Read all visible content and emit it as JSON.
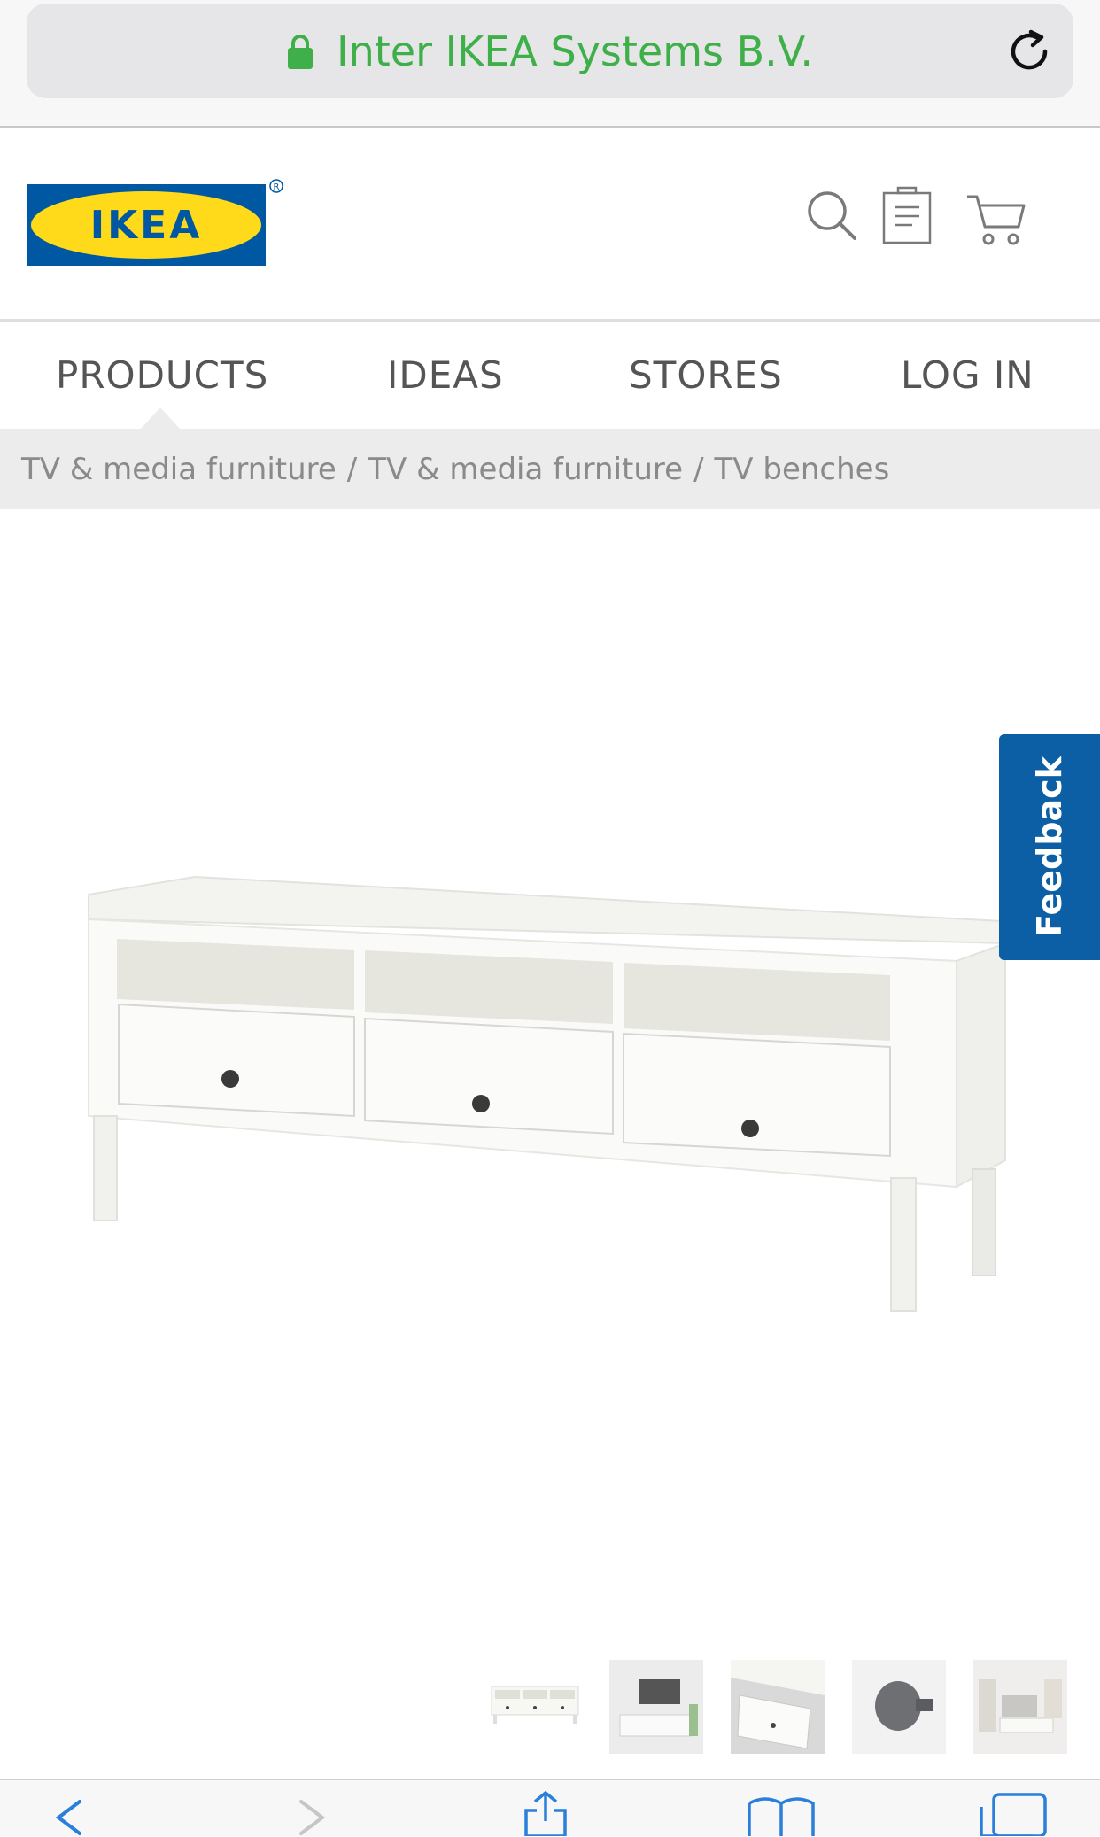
{
  "browser": {
    "url_title": "Inter IKEA Systems B.V.",
    "secure_icon": "lock-icon",
    "reload_icon": "reload-icon",
    "accent_color": "#3fb049"
  },
  "header": {
    "logo_text": "IKEA",
    "logo_mark": "®",
    "icons": [
      "search-icon",
      "shopping-list-icon",
      "cart-icon"
    ]
  },
  "nav": {
    "items": [
      {
        "label": "PRODUCTS",
        "active": true
      },
      {
        "label": "IDEAS"
      },
      {
        "label": "STORES"
      },
      {
        "label": "LOG IN"
      }
    ]
  },
  "breadcrumb": {
    "items": [
      "TV & media furniture",
      "TV & media furniture",
      "TV benches"
    ],
    "separator": "/"
  },
  "feedback": {
    "label": "Feedback",
    "color": "#0c5fa4"
  },
  "thumbnails": [
    "tv-bench-front",
    "tv-bench-living-room",
    "tv-bench-drawer-open",
    "knob-detail",
    "room-setting"
  ],
  "toolbar": {
    "icons": [
      "back-icon",
      "forward-icon",
      "share-icon",
      "bookmarks-icon",
      "tabs-icon"
    ]
  }
}
